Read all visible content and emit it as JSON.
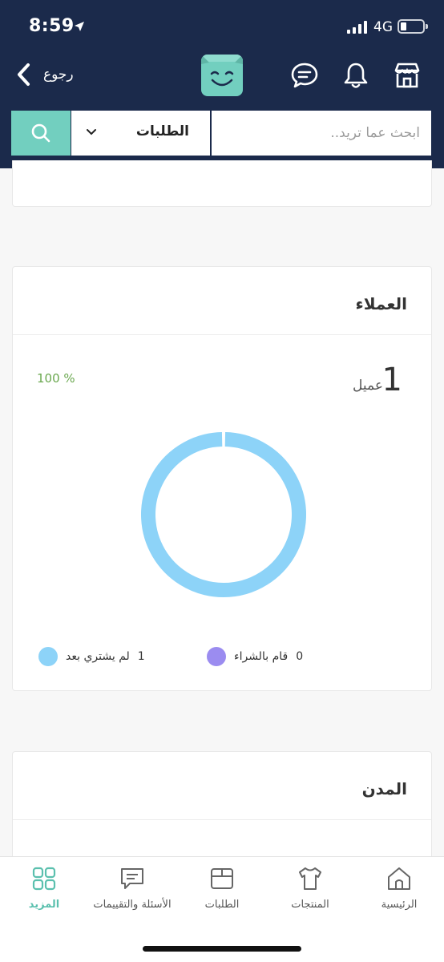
{
  "status": {
    "time": "8:59",
    "network": "4G"
  },
  "nav": {
    "back_label": "رجوع"
  },
  "search": {
    "placeholder": "ابحث عما تريد..",
    "select_value": "الطلبات"
  },
  "customers_card": {
    "title": "العملاء",
    "count": "1",
    "count_unit": "عميل",
    "percent": "100 %",
    "legend": [
      {
        "count": "0",
        "label": "قام بالشراء",
        "color": "#9b8cf0"
      },
      {
        "count": "1",
        "label": "لم يشتري بعد",
        "color": "#8dd3f8"
      }
    ]
  },
  "chart_data": {
    "type": "pie",
    "categories": [
      "قام بالشراء",
      "لم يشتري بعد"
    ],
    "values": [
      0,
      1
    ],
    "colors": [
      "#9b8cf0",
      "#8dd3f8"
    ],
    "title": "",
    "legend_position": "bottom"
  },
  "cities_card": {
    "title": "المدن"
  },
  "tabbar": {
    "items": [
      {
        "label": "الرئيسية",
        "icon": "home-icon"
      },
      {
        "label": "المنتجات",
        "icon": "shirt-icon"
      },
      {
        "label": "الطلبات",
        "icon": "box-icon"
      },
      {
        "label": "الأسئلة والتقييمات",
        "icon": "chat-icon"
      },
      {
        "label": "المزيد",
        "icon": "grid-icon"
      }
    ],
    "active": "المزيد"
  },
  "colors": {
    "header": "#1b2a4b",
    "accent": "#72cfbf",
    "active_tab": "#5bc0ae"
  }
}
